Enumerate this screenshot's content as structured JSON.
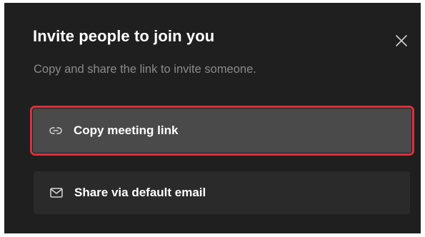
{
  "dialog": {
    "title": "Invite people to join you",
    "subtitle": "Copy and share the link to invite someone."
  },
  "options": [
    {
      "label": "Copy meeting link",
      "icon": "link-icon",
      "highlighted": true
    },
    {
      "label": "Share via default email",
      "icon": "mail-icon",
      "highlighted": false
    }
  ],
  "colors": {
    "background": "#1f1f1f",
    "highlight_outline": "#d9323b",
    "option_selected": "#4a4a4a",
    "option_default": "#2a2a2a"
  }
}
